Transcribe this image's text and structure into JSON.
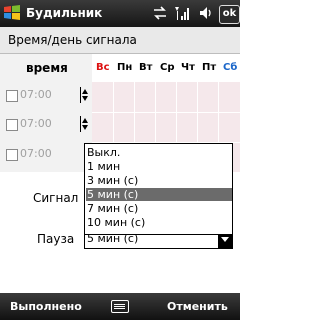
{
  "titlebar": {
    "title": "Будильник",
    "ok_label": "ok",
    "icons": [
      "windows-logo",
      "connectivity-icon",
      "signal-strength-icon",
      "volume-icon"
    ]
  },
  "form": {
    "header": "Время/день сигнала",
    "time_column_label": "время",
    "days": [
      "Вс",
      "Пн",
      "Вт",
      "Ср",
      "Чт",
      "Пт",
      "Сб"
    ],
    "colors": {
      "sunday": "#d11111",
      "saturday": "#1a66c9",
      "grid_bg": "#f5e8eb"
    },
    "alarms": [
      {
        "time": "07:00",
        "checked": false
      },
      {
        "time": "07:00",
        "checked": false
      },
      {
        "time": "07:00",
        "checked": false
      }
    ]
  },
  "signal": {
    "label": "Сигнал"
  },
  "pause": {
    "label": "Пауза",
    "selected": "5 мин (с)",
    "options": [
      "Выкл.",
      "1 мин",
      "3 мин (с)",
      "5 мин (с)",
      "7 мин (с)",
      "10 мин (с)"
    ],
    "highlighted_index": 3
  },
  "softkeys": {
    "left": "Выполнено",
    "right": "Отменить"
  }
}
